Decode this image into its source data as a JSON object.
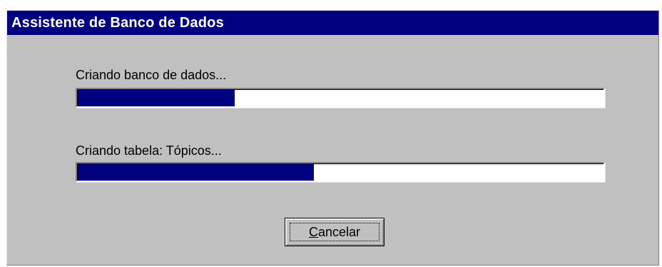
{
  "window": {
    "title": "Assistente de Banco de Dados"
  },
  "tasks": [
    {
      "label": "Criando banco de dados...",
      "progress": 0.3
    },
    {
      "label": "Criando tabela: Tópicos...",
      "progress": 0.45
    }
  ],
  "buttons": {
    "cancel": {
      "accel": "C",
      "rest": "ancelar",
      "label": "Cancelar"
    }
  },
  "colors": {
    "titlebar": "#000080",
    "progress_fill": "#000080",
    "window_bg": "#c0c0c0"
  }
}
